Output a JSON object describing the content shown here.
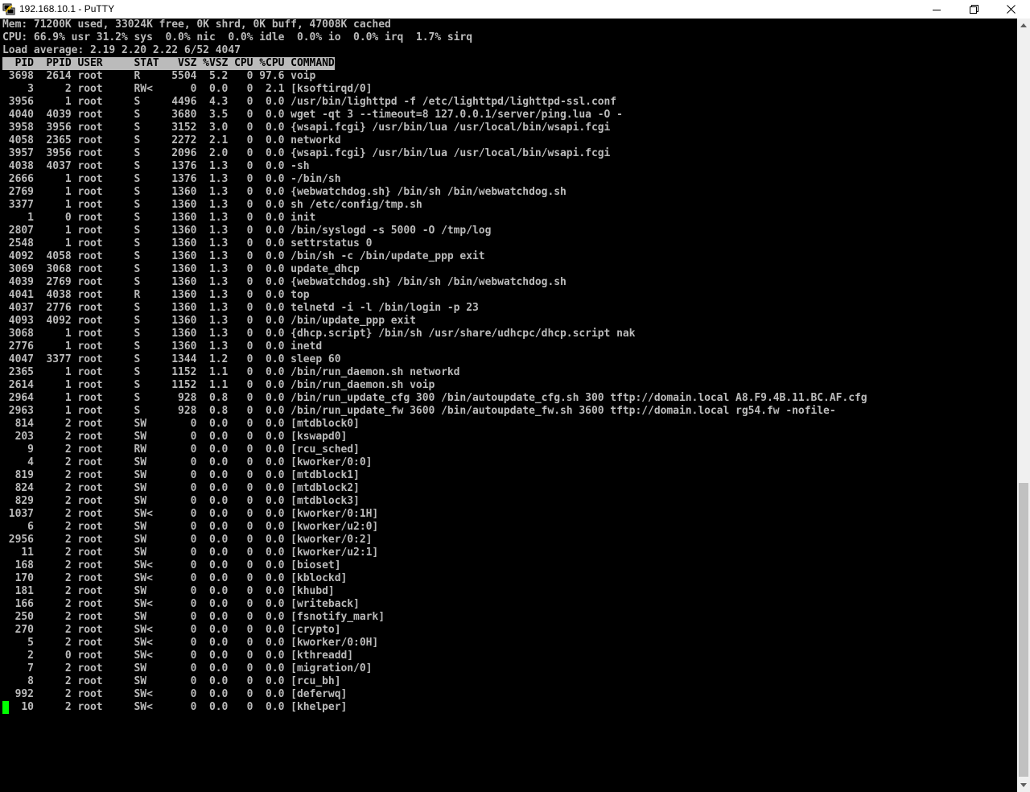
{
  "window": {
    "title": "192.168.10.1 - PuTTY",
    "icons": {
      "app": "putty-icon",
      "minimize": "minimize-icon",
      "maximize": "restore-icon",
      "close": "close-icon"
    }
  },
  "colors": {
    "background": "#000000",
    "foreground": "#bbbbbb",
    "cursor": "#00ff00",
    "header_bg": "#bbbbbb"
  },
  "terminal": {
    "summary": [
      "Mem: 71200K used, 33024K free, 0K shrd, 0K buff, 47008K cached",
      "CPU: 66.9% usr 31.2% sys  0.0% nic  0.0% idle  0.0% io  0.0% irq  1.7% sirq",
      "Load average: 2.19 2.20 2.22 6/52 4047"
    ],
    "header": "  PID  PPID USER     STAT   VSZ %VSZ CPU %CPU COMMAND",
    "rows": [
      " 3698  2614 root     R     5504  5.2   0 97.6 voip",
      "    3     2 root     RW<      0  0.0   0  2.1 [ksoftirqd/0]",
      " 3956     1 root     S     4496  4.3   0  0.0 /usr/bin/lighttpd -f /etc/lighttpd/lighttpd-ssl.conf",
      " 4040  4039 root     S     3680  3.5   0  0.0 wget -qt 3 --timeout=8 127.0.0.1/server/ping.lua -O -",
      " 3958  3956 root     S     3152  3.0   0  0.0 {wsapi.fcgi} /usr/bin/lua /usr/local/bin/wsapi.fcgi",
      " 4058  2365 root     S     2272  2.1   0  0.0 networkd",
      " 3957  3956 root     S     2096  2.0   0  0.0 {wsapi.fcgi} /usr/bin/lua /usr/local/bin/wsapi.fcgi",
      " 4038  4037 root     S     1376  1.3   0  0.0 -sh",
      " 2666     1 root     S     1376  1.3   0  0.0 -/bin/sh",
      " 2769     1 root     S     1360  1.3   0  0.0 {webwatchdog.sh} /bin/sh /bin/webwatchdog.sh",
      " 3377     1 root     S     1360  1.3   0  0.0 sh /etc/config/tmp.sh",
      "    1     0 root     S     1360  1.3   0  0.0 init",
      " 2807     1 root     S     1360  1.3   0  0.0 /bin/syslogd -s 5000 -O /tmp/log",
      " 2548     1 root     S     1360  1.3   0  0.0 settrstatus 0",
      " 4092  4058 root     S     1360  1.3   0  0.0 /bin/sh -c /bin/update_ppp exit",
      " 3069  3068 root     S     1360  1.3   0  0.0 update_dhcp",
      " 4039  2769 root     S     1360  1.3   0  0.0 {webwatchdog.sh} /bin/sh /bin/webwatchdog.sh",
      " 4041  4038 root     R     1360  1.3   0  0.0 top",
      " 4037  2776 root     S     1360  1.3   0  0.0 telnetd -i -l /bin/login -p 23",
      " 4093  4092 root     S     1360  1.3   0  0.0 /bin/update_ppp exit",
      " 3068     1 root     S     1360  1.3   0  0.0 {dhcp.script} /bin/sh /usr/share/udhcpc/dhcp.script nak",
      " 2776     1 root     S     1360  1.3   0  0.0 inetd",
      " 4047  3377 root     S     1344  1.2   0  0.0 sleep 60",
      " 2365     1 root     S     1152  1.1   0  0.0 /bin/run_daemon.sh networkd",
      " 2614     1 root     S     1152  1.1   0  0.0 /bin/run_daemon.sh voip",
      " 2964     1 root     S      928  0.8   0  0.0 /bin/run_update_cfg 300 /bin/autoupdate_cfg.sh 300 tftp://domain.local A8.F9.4B.11.BC.AF.cfg",
      " 2963     1 root     S      928  0.8   0  0.0 /bin/run_update_fw 3600 /bin/autoupdate_fw.sh 3600 tftp://domain.local rg54.fw -nofile-",
      "  814     2 root     SW       0  0.0   0  0.0 [mtdblock0]",
      "  203     2 root     SW       0  0.0   0  0.0 [kswapd0]",
      "    9     2 root     RW       0  0.0   0  0.0 [rcu_sched]",
      "    4     2 root     SW       0  0.0   0  0.0 [kworker/0:0]",
      "  819     2 root     SW       0  0.0   0  0.0 [mtdblock1]",
      "  824     2 root     SW       0  0.0   0  0.0 [mtdblock2]",
      "  829     2 root     SW       0  0.0   0  0.0 [mtdblock3]",
      " 1037     2 root     SW<      0  0.0   0  0.0 [kworker/0:1H]",
      "    6     2 root     SW       0  0.0   0  0.0 [kworker/u2:0]",
      " 2956     2 root     SW       0  0.0   0  0.0 [kworker/0:2]",
      "   11     2 root     SW       0  0.0   0  0.0 [kworker/u2:1]",
      "  168     2 root     SW<      0  0.0   0  0.0 [bioset]",
      "  170     2 root     SW<      0  0.0   0  0.0 [kblockd]",
      "  181     2 root     SW       0  0.0   0  0.0 [khubd]",
      "  166     2 root     SW<      0  0.0   0  0.0 [writeback]",
      "  250     2 root     SW       0  0.0   0  0.0 [fsnotify_mark]",
      "  270     2 root     SW<      0  0.0   0  0.0 [crypto]",
      "    5     2 root     SW<      0  0.0   0  0.0 [kworker/0:0H]",
      "    2     0 root     SW<      0  0.0   0  0.0 [kthreadd]",
      "    7     2 root     SW       0  0.0   0  0.0 [migration/0]",
      "    8     2 root     SW       0  0.0   0  0.0 [rcu_bh]",
      "  992     2 root     SW<      0  0.0   0  0.0 [deferwq]",
      "   10     2 root     SW<      0  0.0   0  0.0 [khelper]"
    ]
  }
}
